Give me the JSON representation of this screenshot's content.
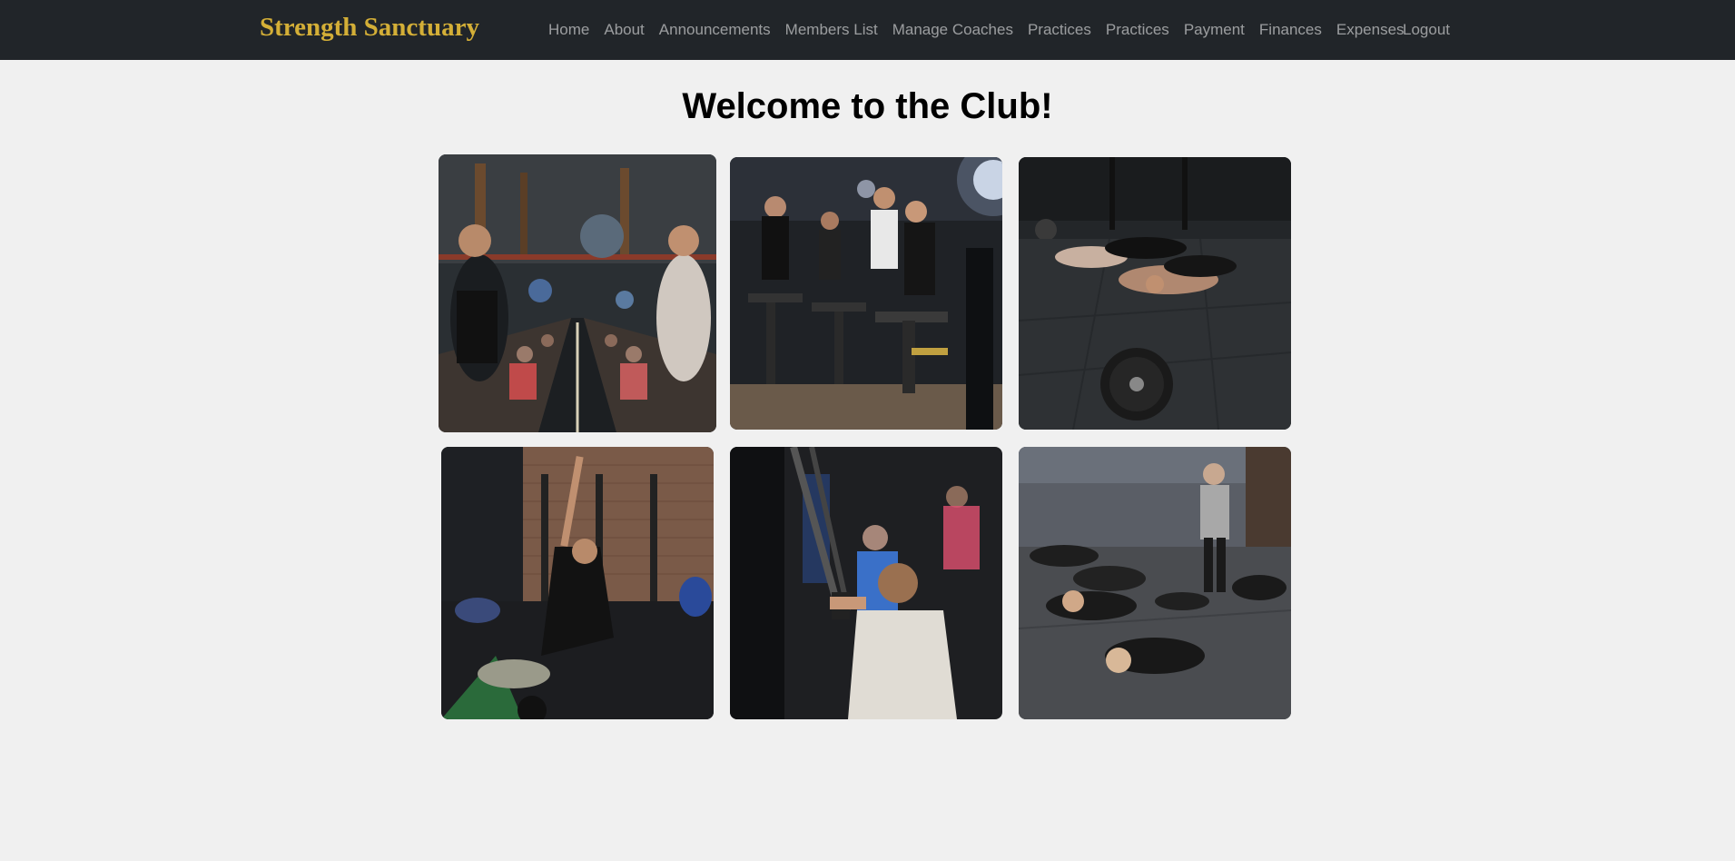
{
  "navbar": {
    "brand": "Strength Sanctuary",
    "brand_color": "#d4af37",
    "background": "#212529",
    "links": [
      {
        "label": "Home"
      },
      {
        "label": "About"
      },
      {
        "label": "Announcements"
      },
      {
        "label": "Members List"
      },
      {
        "label": "Manage Coaches"
      },
      {
        "label": "Practices"
      },
      {
        "label": "Practices"
      },
      {
        "label": "Payment"
      },
      {
        "label": "Finances"
      },
      {
        "label": "Expenses"
      }
    ],
    "logout_label": "Logout"
  },
  "main": {
    "title": "Welcome to the Club!",
    "gallery": [
      {
        "subject": "functional-training-ball-throw-photo"
      },
      {
        "subject": "spin-cycling-class-photo"
      },
      {
        "subject": "push-up-group-with-weight-plate-photo"
      },
      {
        "subject": "side-plank-stretch-photo"
      },
      {
        "subject": "suspension-trx-training-photo"
      },
      {
        "subject": "floor-crunch-class-with-coach-photo"
      }
    ]
  }
}
